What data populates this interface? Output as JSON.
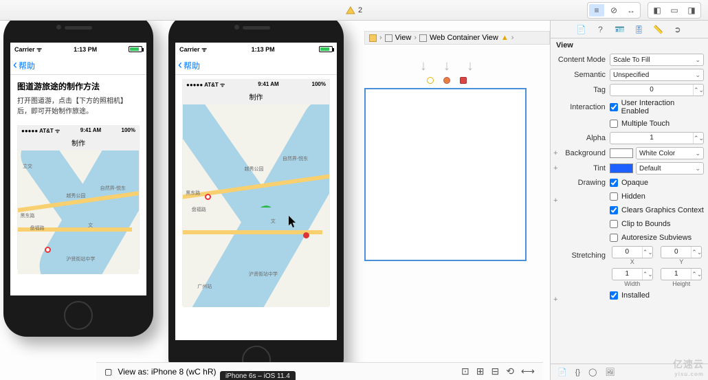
{
  "toolbar": {
    "warning_count": "2"
  },
  "breadcrumb": {
    "items": [
      "",
      "View",
      "Web Container View"
    ]
  },
  "phone_status": {
    "carrier": "Carrier ᯤ",
    "time": "1:13 PM"
  },
  "phone1": {
    "nav_back": "帮助",
    "article_title": "图道游旅途的制作方法",
    "article_body": "打开图道游，点击【下方的照相机】后，即可开始制作旅途。"
  },
  "phone2": {
    "nav_back": "帮助"
  },
  "inner_shot": {
    "carrier": "●●●●● AT&T ᯤ",
    "time": "9:41 AM",
    "battery": "100%",
    "title": "制作"
  },
  "map_labels": {
    "l1": "越秀公园",
    "l2": "自然界-悦东",
    "l3": "盘福路",
    "l4": "文",
    "l5": "沪贤街站中学",
    "l6": "黑东路",
    "l7": "广州站",
    "l8": "立交"
  },
  "inspector": {
    "header": "View",
    "content_mode": {
      "label": "Content Mode",
      "value": "Scale To Fill"
    },
    "semantic": {
      "label": "Semantic",
      "value": "Unspecified"
    },
    "tag": {
      "label": "Tag",
      "value": "0"
    },
    "interaction": {
      "label": "Interaction",
      "user_interaction": "User Interaction Enabled",
      "multiple_touch": "Multiple Touch"
    },
    "alpha": {
      "label": "Alpha",
      "value": "1"
    },
    "background": {
      "label": "Background",
      "value": "White Color",
      "swatch": "#ffffff"
    },
    "tint": {
      "label": "Tint",
      "value": "Default",
      "swatch": "#1e60ff"
    },
    "drawing": {
      "label": "Drawing",
      "opaque": "Opaque",
      "hidden": "Hidden",
      "clears": "Clears Graphics Context",
      "clip": "Clip to Bounds",
      "autoresize": "Autoresize Subviews"
    },
    "stretching": {
      "label": "Stretching",
      "x": "0",
      "y": "0",
      "w": "1",
      "h": "1",
      "xl": "X",
      "yl": "Y",
      "wl": "Width",
      "hl": "Height"
    },
    "installed": "Installed"
  },
  "device_bar": {
    "view_as": "View as: iPhone 8 (wC hR)",
    "popover": "iPhone 6s – iOS 11.4"
  },
  "watermark": {
    "main": "亿速云",
    "sub": "yisu.com"
  }
}
